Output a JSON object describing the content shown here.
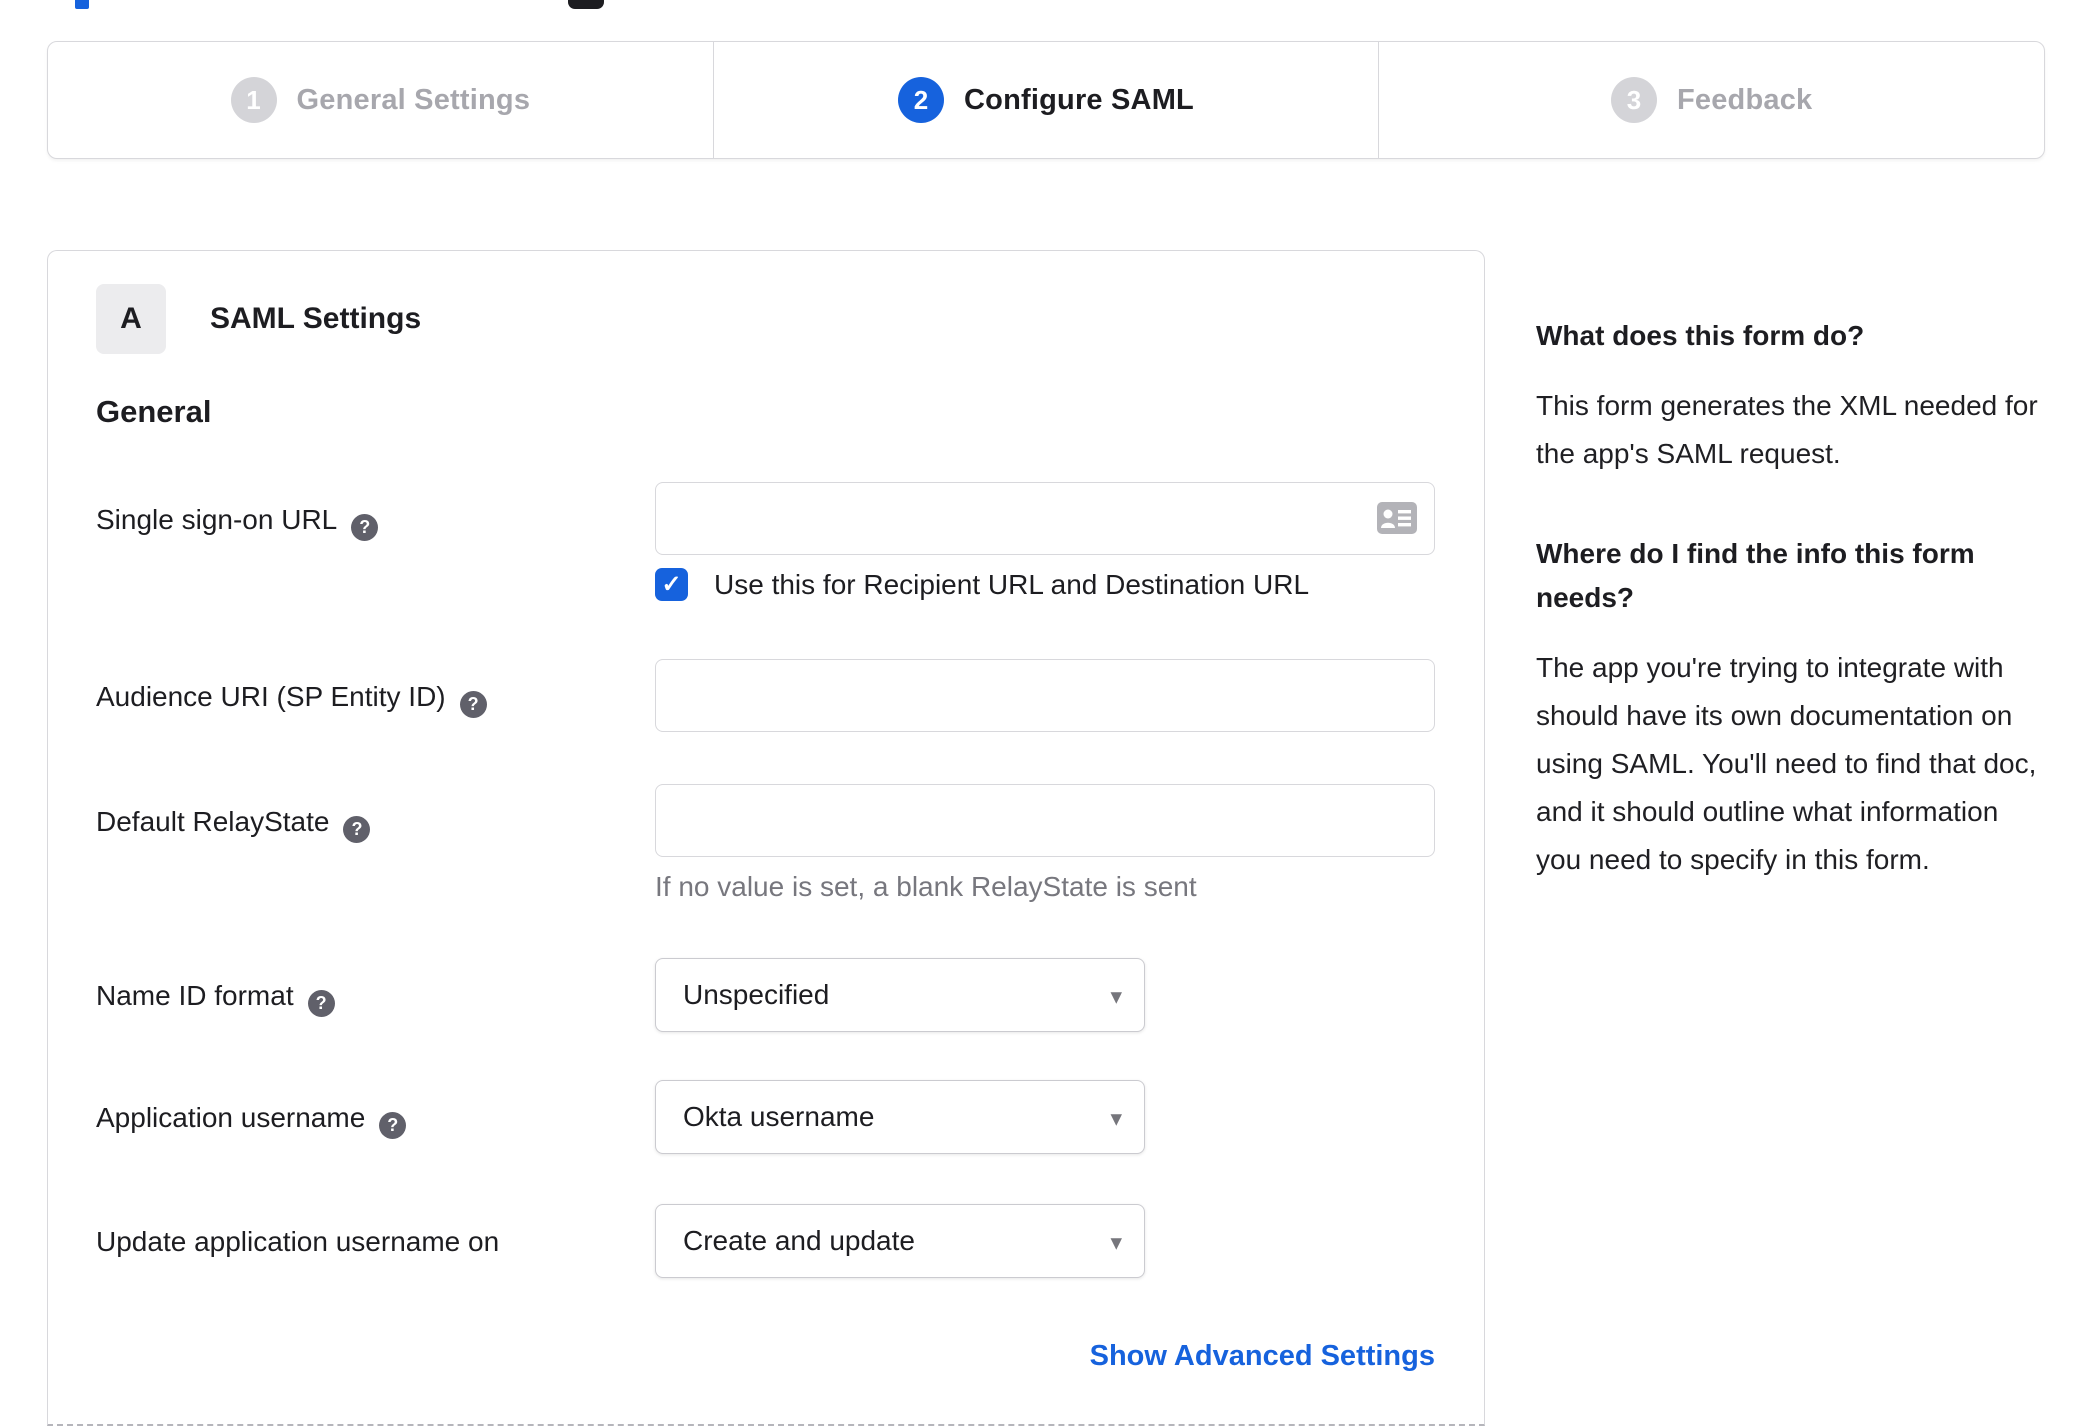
{
  "icons": {
    "help_glyph": "?",
    "check_glyph": "✓",
    "select_arrow_glyph": "▾"
  },
  "stepper": {
    "steps": [
      {
        "number": "1",
        "label": "General Settings",
        "active": false
      },
      {
        "number": "2",
        "label": "Configure SAML",
        "active": true
      },
      {
        "number": "3",
        "label": "Feedback",
        "active": false
      }
    ]
  },
  "card": {
    "badge": "A",
    "title": "SAML Settings",
    "section_heading": "General",
    "rows": [
      {
        "label": "Single sign-on URL",
        "type": "text",
        "value": "",
        "checkbox_label": "Use this for Recipient URL and Destination URL",
        "checked": true
      },
      {
        "label": "Audience URI (SP Entity ID)",
        "type": "text",
        "value": ""
      },
      {
        "label": "Default RelayState",
        "type": "text",
        "value": "",
        "helper": "If no value is set, a blank RelayState is sent"
      },
      {
        "label": "Name ID format",
        "type": "select",
        "value": "Unspecified"
      },
      {
        "label": "Application username",
        "type": "select",
        "value": "Okta username"
      },
      {
        "label": "Update application username on",
        "type": "select",
        "value": "Create and update"
      }
    ],
    "advanced_link": "Show Advanced Settings"
  },
  "sidebar": {
    "blocks": [
      {
        "heading": "What does this form do?",
        "body": "This form generates the XML needed for the app's SAML request."
      },
      {
        "heading": "Where do I find the info this form needs?",
        "body": "The app you're trying to integrate with should have its own documentation on using SAML. You'll need to find that doc, and it should outline what information you need to specify in this form."
      }
    ]
  },
  "colors": {
    "accent_blue": "#1662dd",
    "inactive_gray": "#d4d4d8",
    "text_dark": "#1d1d21",
    "muted_text": "#77777e",
    "border": "#d8d8dc",
    "link_blue": "#1662dd"
  }
}
